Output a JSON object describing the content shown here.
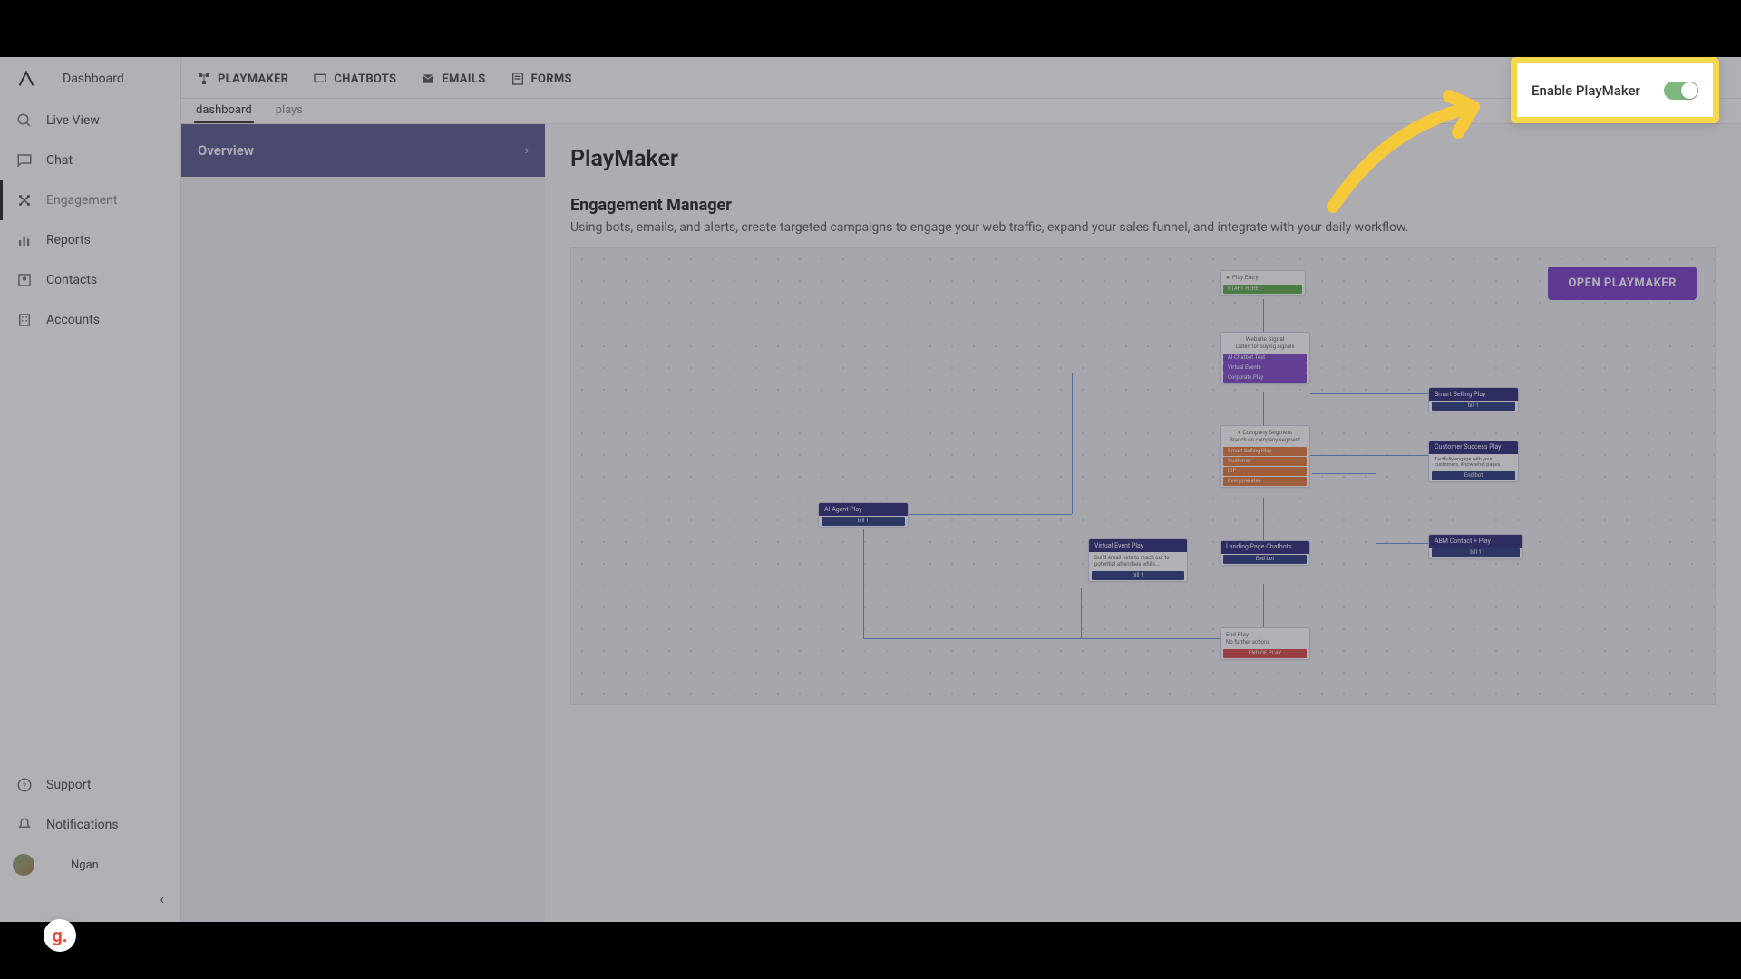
{
  "sidebar": {
    "items": [
      {
        "label": "Dashboard"
      },
      {
        "label": "Live View"
      },
      {
        "label": "Chat"
      },
      {
        "label": "Engagement"
      },
      {
        "label": "Reports"
      },
      {
        "label": "Contacts"
      },
      {
        "label": "Accounts"
      }
    ],
    "bottom": {
      "support": "Support",
      "notifications": "Notifications",
      "user_name": "Ngan"
    }
  },
  "topbar": {
    "tabs": [
      {
        "label": "PLAYMAKER"
      },
      {
        "label": "CHATBOTS"
      },
      {
        "label": "EMAILS"
      },
      {
        "label": "FORMS"
      }
    ],
    "subtabs": [
      {
        "label": "dashboard"
      },
      {
        "label": "plays"
      }
    ]
  },
  "left_panel": {
    "overview": "Overview"
  },
  "content": {
    "page_title": "PlayMaker",
    "section_title": "Engagement Manager",
    "section_desc": "Using bots, emails, and alerts, create targeted campaigns to engage your web traffic, expand your sales funnel, and integrate with your daily workflow.",
    "open_button": "OPEN PLAYMAKER"
  },
  "highlight": {
    "enable_label": "Enable PlayMaker"
  },
  "flow": {
    "play_entry": {
      "title": "Play Entry",
      "start": "START HERE"
    },
    "website_signal": {
      "title": "Website Signal",
      "desc": "Listen for buying signals",
      "s1": "AI Chatbot Test",
      "s2": "Virtual Events",
      "s3": "Corporate Play"
    },
    "company_segment": {
      "title": "Company Segment",
      "desc": "Branch on company segment",
      "s1": "Smart Selling Play",
      "s2": "Customer",
      "s3": "ICP",
      "s4": "Everyone else"
    },
    "ai_agent": {
      "title": "AI Agent Play",
      "t1": "bill 1"
    },
    "virtual_event": {
      "title": "Virtual Event Play",
      "desc": "Build email nets to reach out to potential attendees while...",
      "t1": "bill 1"
    },
    "landing": {
      "title": "Landing Page Chatbots",
      "t1": "End bot"
    },
    "smart_selling": {
      "title": "Smart Selling Play",
      "t1": "bill 1"
    },
    "customer_success": {
      "title": "Customer Success Play",
      "desc": "Tactfully engage with your customers. Know what pages...",
      "t1": "End bot"
    },
    "abm": {
      "title": "ABM Contact + Play",
      "t1": "bill 1"
    },
    "end_play": {
      "title": "End Play",
      "desc": "No further actions",
      "t1": "END OF PLAY"
    }
  },
  "g_badge": "g."
}
